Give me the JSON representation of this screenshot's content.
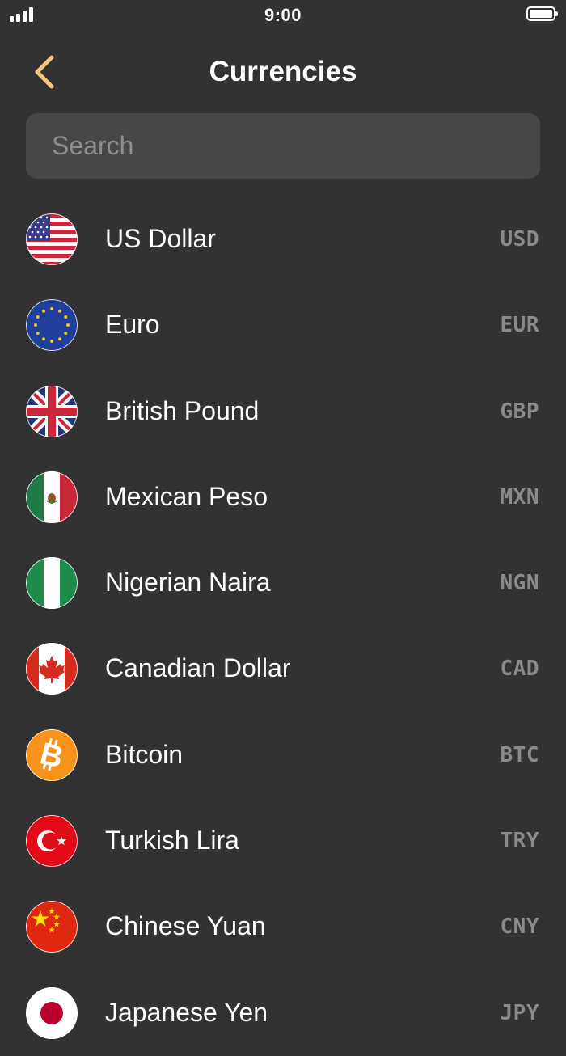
{
  "status_bar": {
    "time": "9:00"
  },
  "header": {
    "title": "Currencies"
  },
  "search": {
    "placeholder": "Search",
    "value": ""
  },
  "currencies": [
    {
      "name": "US Dollar",
      "code": "USD",
      "icon": "us-flag-icon"
    },
    {
      "name": "Euro",
      "code": "EUR",
      "icon": "eu-flag-icon"
    },
    {
      "name": "British Pound",
      "code": "GBP",
      "icon": "uk-flag-icon"
    },
    {
      "name": "Mexican Peso",
      "code": "MXN",
      "icon": "mexico-flag-icon"
    },
    {
      "name": "Nigerian Naira",
      "code": "NGN",
      "icon": "nigeria-flag-icon"
    },
    {
      "name": "Canadian Dollar",
      "code": "CAD",
      "icon": "canada-flag-icon"
    },
    {
      "name": "Bitcoin",
      "code": "BTC",
      "icon": "bitcoin-icon"
    },
    {
      "name": "Turkish Lira",
      "code": "TRY",
      "icon": "turkey-flag-icon"
    },
    {
      "name": "Chinese Yuan",
      "code": "CNY",
      "icon": "china-flag-icon"
    },
    {
      "name": "Japanese Yen",
      "code": "JPY",
      "icon": "japan-flag-icon"
    }
  ],
  "colors": {
    "background": "#323232",
    "search_field": "#474747",
    "accent_back": "#f6c77a",
    "code_text": "#8a8a8a"
  }
}
